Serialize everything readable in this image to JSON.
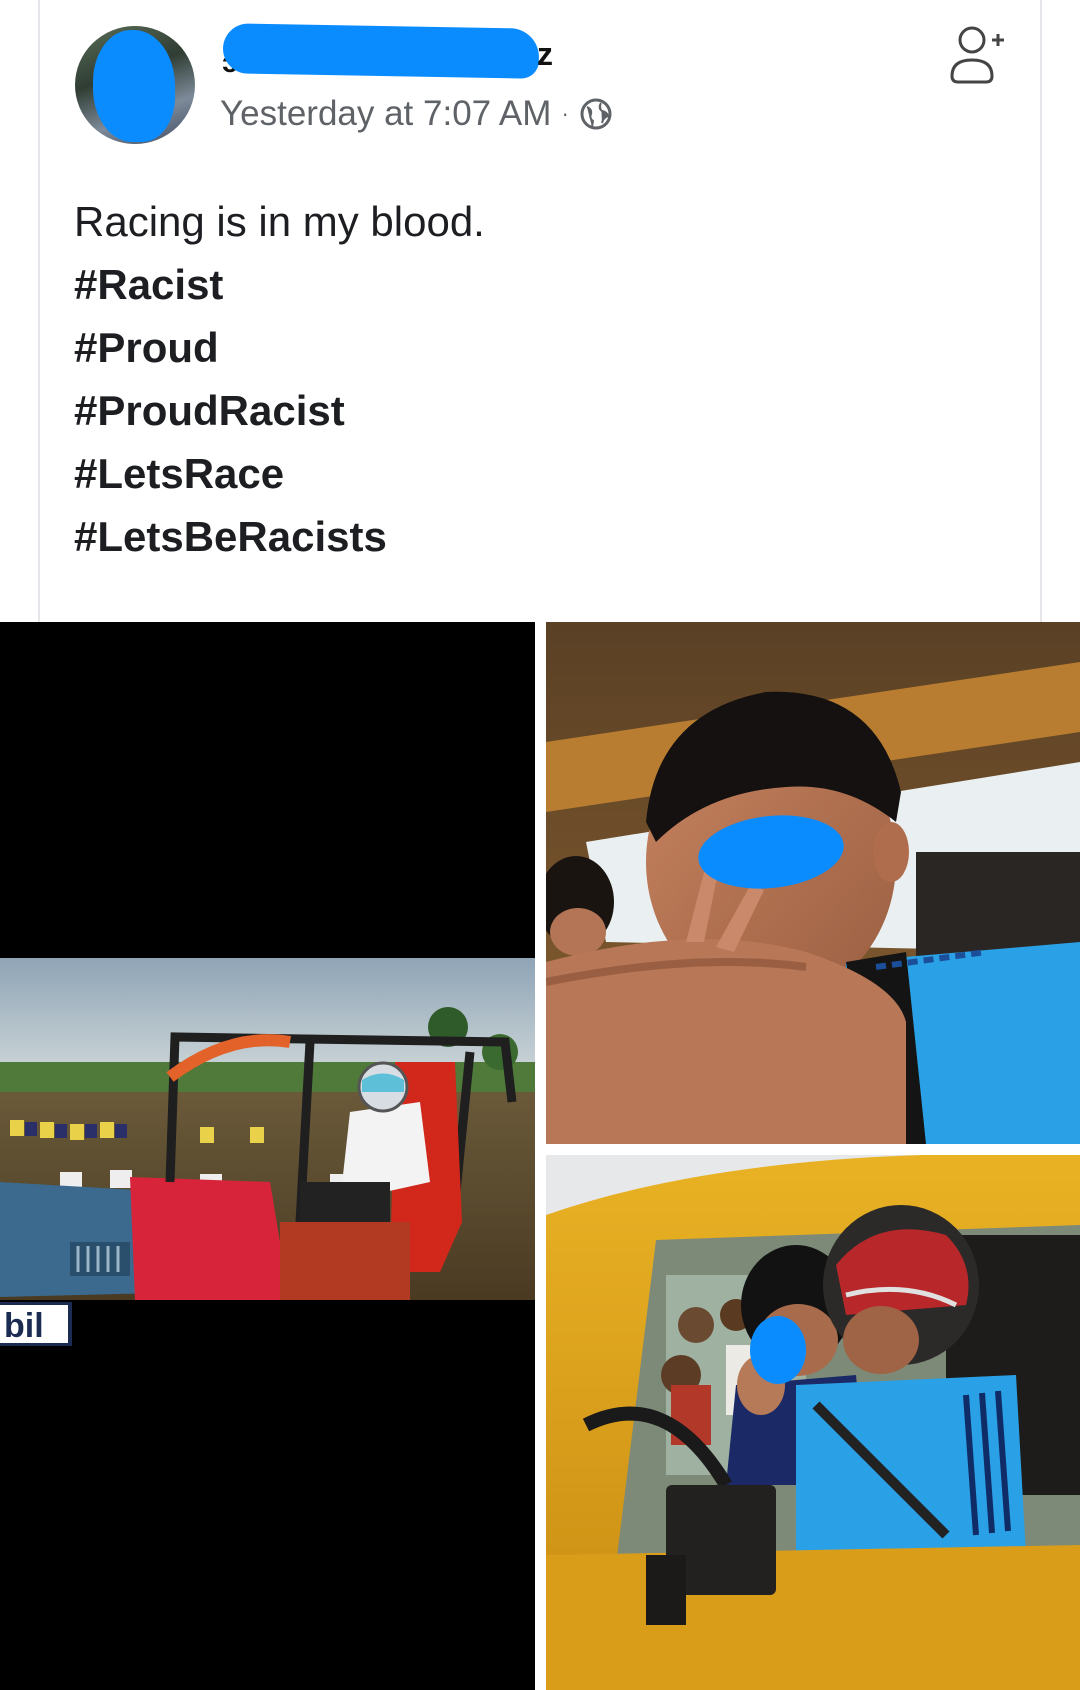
{
  "post": {
    "author_name_left_fragment": "ɔɐ..",
    "author_name_right_fragment": "z",
    "timestamp": "Yesterday at 7:07 AM",
    "separator": "·",
    "privacy_icon": "globe-icon",
    "action_icon": "add-friend-icon",
    "text": {
      "caption": "Racing is in my blood.",
      "hashtags": [
        "#Racist",
        "#Proud",
        "#ProudRacist",
        "#LetsRace",
        "#LetsBeRacists"
      ]
    }
  },
  "photos": {
    "left": {
      "sponsor_text": "bil"
    }
  },
  "colors": {
    "redaction_blue": "#0a8cff",
    "meta_gray": "#5f6368",
    "text_dark": "#1c1e21",
    "jeep_red": "#d8243a",
    "jeep_blue": "#3b6a8e",
    "car_yellow": "#e0a317",
    "shirt_blue": "#2aa0e6"
  }
}
